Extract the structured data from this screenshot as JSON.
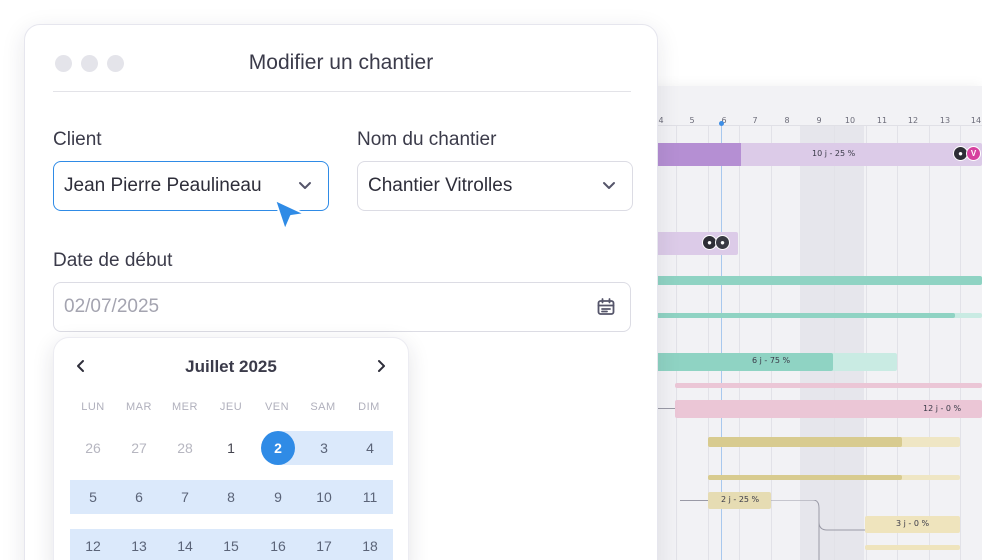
{
  "modal": {
    "title": "Modifier un chantier",
    "client_label": "Client",
    "client_value": "Jean Pierre Peaulineau",
    "site_label": "Nom du chantier",
    "site_value": "Chantier Vitrolles",
    "start_date_label": "Date de début",
    "start_date_value": "02/07/2025"
  },
  "calendar": {
    "month": "Juillet 2025",
    "weekdays": [
      "LUN",
      "MAR",
      "MER",
      "JEU",
      "VEN",
      "SAM",
      "DIM"
    ],
    "weeks": [
      [
        "26",
        "27",
        "28",
        "1",
        "2",
        "3",
        "4"
      ],
      [
        "5",
        "6",
        "7",
        "8",
        "9",
        "10",
        "11"
      ],
      [
        "12",
        "13",
        "14",
        "15",
        "16",
        "17",
        "18"
      ]
    ],
    "selected_day": "2"
  },
  "gantt": {
    "ticks": [
      "4",
      "5",
      "6",
      "7",
      "8",
      "9",
      "10",
      "11",
      "12",
      "13",
      "14"
    ],
    "bars": [
      {
        "label": "10 j - 25 %",
        "color": "#b58fd3",
        "light": "#dccbe8",
        "progress": 0.25,
        "avatars": [
          "dark",
          "V"
        ]
      },
      {
        "label": "",
        "color": "#dccbe8",
        "avatars": [
          "dark",
          "dark"
        ]
      },
      {
        "label": "6 j - 75 %",
        "color": "#8fd3c3",
        "light": "#c9ebe3",
        "progress": 0.75
      },
      {
        "label": "12 j - 0 %",
        "color": "#ebc6d6",
        "progress": 0
      },
      {
        "label": "2 j - 25 %",
        "color": "#e6dcb3",
        "progress": 0.25
      },
      {
        "label": "3 j - 0 %",
        "color": "#efe4bd",
        "progress": 0
      }
    ],
    "avatar_letter": "V",
    "avatar_color": "#d6409f"
  }
}
